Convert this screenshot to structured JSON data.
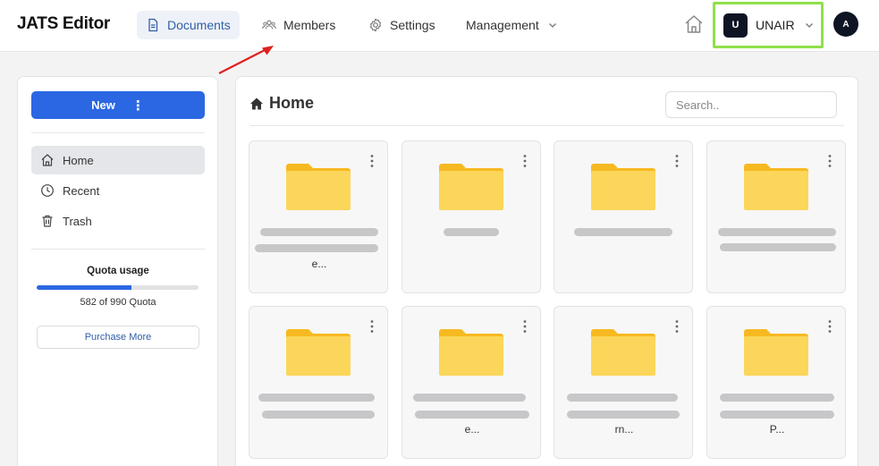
{
  "header": {
    "brand": "JATS Editor",
    "nav": [
      {
        "label": "Documents",
        "icon": "document-icon",
        "active": true
      },
      {
        "label": "Members",
        "icon": "members-icon"
      },
      {
        "label": "Settings",
        "icon": "gear-icon"
      },
      {
        "label": "Management",
        "icon": "chevron-down-icon"
      }
    ],
    "org": {
      "initial": "U",
      "name": "UNAIR"
    },
    "user_initial": "A",
    "highlight_color": "#8fe04a",
    "annotation_color": "#e02020"
  },
  "sidebar": {
    "new_label": "New",
    "new_menu_glyph": "⋮",
    "items": [
      {
        "label": "Home",
        "icon": "home-icon",
        "active": true
      },
      {
        "label": "Recent",
        "icon": "clock-icon"
      },
      {
        "label": "Trash",
        "icon": "trash-icon"
      }
    ],
    "quota": {
      "title": "Quota usage",
      "used": 582,
      "total": 990,
      "text": "582 of 990 Quota",
      "fraction": 0.588
    },
    "purchase_label": "Purchase More"
  },
  "main": {
    "title": "Home",
    "search_placeholder": "Search..",
    "accent": "#2b67e3",
    "folder_color": "#fcd65a",
    "folders": [
      {
        "visible_tail": "e..."
      },
      {
        "visible_tail": ""
      },
      {
        "visible_tail": ""
      },
      {
        "visible_tail": ""
      },
      {
        "visible_tail": ""
      },
      {
        "visible_tail": "e..."
      },
      {
        "visible_tail": "rn..."
      },
      {
        "visible_tail": "P..."
      }
    ]
  }
}
